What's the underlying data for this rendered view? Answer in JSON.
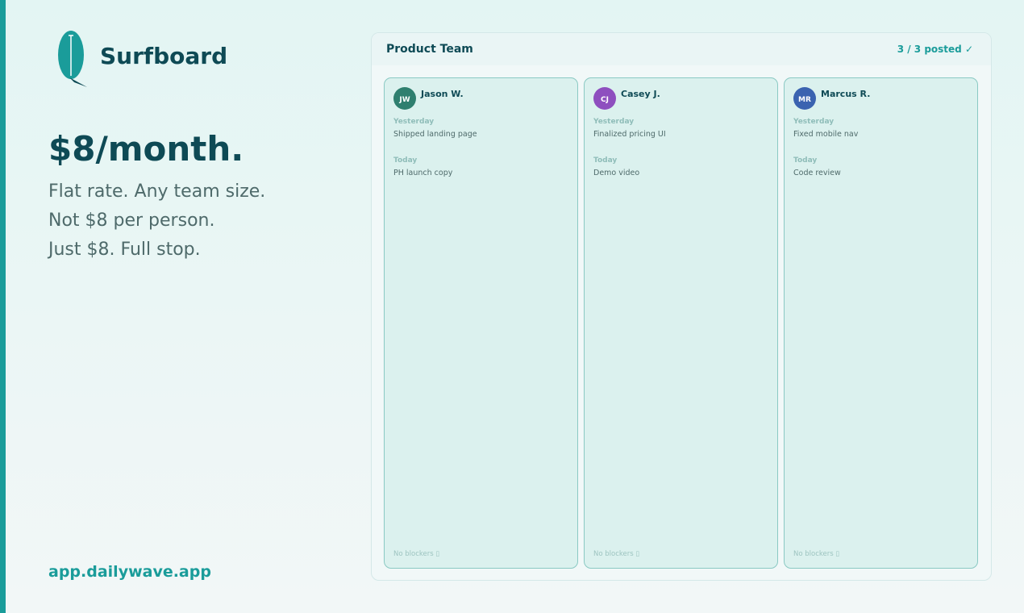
{
  "brand": {
    "name": "Surfboard",
    "logo_icon": "surfboard-icon",
    "color": "#0e4a55",
    "accent": "#1a9c9a"
  },
  "hero": {
    "headline": "$8/month.",
    "taglines": [
      "Flat rate. Any team size.",
      "Not $8 per person.",
      "Just $8. Full stop."
    ]
  },
  "footer": {
    "link": "app.dailywave.app"
  },
  "board": {
    "title": "Product Team",
    "status": "3 / 3 posted  ✓",
    "members": [
      {
        "initials": "JW",
        "name": "Jason W.",
        "avatar_color": "#2f7f6f",
        "yesterday_label": "Yesterday",
        "yesterday": "Shipped landing page",
        "today_label": "Today",
        "today": "PH launch copy",
        "blockers": "No blockers ▯"
      },
      {
        "initials": "CJ",
        "name": "Casey J.",
        "avatar_color": "#8e4fbf",
        "yesterday_label": "Yesterday",
        "yesterday": "Finalized pricing UI",
        "today_label": "Today",
        "today": "Demo video",
        "blockers": "No blockers ▯"
      },
      {
        "initials": "MR",
        "name": "Marcus R.",
        "avatar_color": "#3b63b0",
        "yesterday_label": "Yesterday",
        "yesterday": "Fixed mobile nav",
        "today_label": "Today",
        "today": "Code review",
        "blockers": "No blockers ▯"
      }
    ]
  }
}
